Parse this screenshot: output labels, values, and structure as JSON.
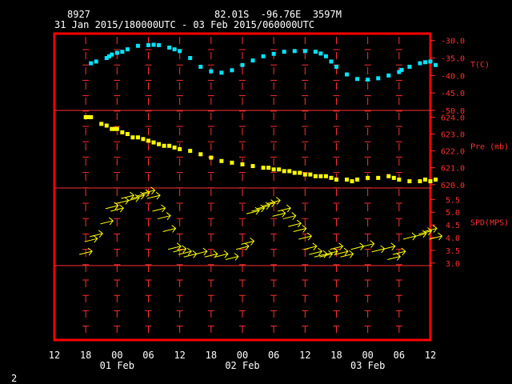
{
  "header": {
    "station": "8927",
    "location": "82.01S  -96.76E  3597M",
    "time_range": "31 Jan 2015/180000UTC - 03 Feb 2015/060000UTC"
  },
  "footer": {
    "page_number": "2"
  },
  "colors": {
    "background": "#000000",
    "frame": "#ff0000",
    "axis": "#ff3030",
    "temperature": "#00e5ff",
    "pressure": "#ffff00",
    "wind": "#ffff00",
    "text": "#ffffff"
  },
  "chart_data": [
    {
      "type": "scatter",
      "ylabel": "T(C)",
      "ylim": [
        -50,
        -28
      ],
      "yticks": [
        "-30.0",
        "-35.0",
        "-40.0",
        "-45.0",
        "-50.0"
      ],
      "x_hours": [
        19,
        20,
        22,
        22.5,
        23,
        24,
        25,
        26,
        28,
        30,
        31,
        32,
        34,
        35,
        36,
        38,
        40,
        42,
        44,
        46,
        48,
        50,
        52,
        54,
        56,
        58,
        60,
        62,
        63,
        64,
        65,
        66,
        68,
        70,
        72,
        74,
        76,
        78,
        78.5,
        80,
        82,
        83,
        84,
        85
      ],
      "values": [
        -36.5,
        -36,
        -35,
        -34.5,
        -34,
        -33.5,
        -33.2,
        -32.5,
        -31.5,
        -31.3,
        -31.2,
        -31.3,
        -32,
        -32.5,
        -33,
        -35,
        -37.5,
        -38.8,
        -39.2,
        -38.5,
        -37,
        -35.7,
        -34.5,
        -33.8,
        -33.2,
        -33,
        -33,
        -33.2,
        -33.7,
        -34.5,
        -36,
        -37.5,
        -39.7,
        -41,
        -41.2,
        -40.8,
        -40,
        -39,
        -38.4,
        -37.5,
        -36.5,
        -36.2,
        -36,
        -37
      ]
    },
    {
      "type": "scatter",
      "ylabel": "Pre (mb)",
      "ylim": [
        619.8,
        624.4
      ],
      "yticks": [
        "624.0",
        "623.0",
        "622.0",
        "621.0",
        "620.0"
      ],
      "x_hours": [
        18,
        18.5,
        19,
        21,
        22,
        23,
        23.5,
        24,
        25,
        26,
        27,
        28,
        29,
        30,
        31,
        32,
        33,
        34,
        35,
        36,
        38,
        40,
        42,
        44,
        46,
        48,
        50,
        52,
        53,
        54,
        55,
        56,
        57,
        58,
        59,
        60,
        61,
        62,
        63,
        64,
        65,
        66,
        68,
        69,
        70,
        72,
        74,
        76,
        77,
        78,
        80,
        82,
        83,
        84,
        85
      ],
      "values": [
        624,
        624,
        624,
        623.6,
        623.5,
        623.3,
        623.3,
        623.3,
        623.1,
        623,
        622.8,
        622.8,
        622.7,
        622.6,
        622.5,
        622.4,
        622.3,
        622.3,
        622.2,
        622.1,
        622,
        621.8,
        621.6,
        621.4,
        621.3,
        621.2,
        621.1,
        621,
        621,
        620.9,
        620.9,
        620.8,
        620.8,
        620.7,
        620.7,
        620.6,
        620.6,
        620.5,
        620.5,
        620.5,
        620.4,
        620.3,
        620.3,
        620.2,
        620.3,
        620.4,
        620.4,
        620.5,
        620.4,
        620.3,
        620.2,
        620.2,
        620.3,
        620.2,
        620.3
      ]
    },
    {
      "type": "scatter",
      "ylabel": "SPD(MPS)",
      "ylim": [
        2.9,
        5.95
      ],
      "yticks": [
        "5.5",
        "5.0",
        "4.5",
        "4.0",
        "3.5",
        "3.0"
      ],
      "x_hours": [
        18,
        19,
        20,
        22,
        23,
        24,
        25,
        26,
        27,
        28,
        29,
        30,
        31,
        32,
        33,
        34,
        35,
        36,
        37,
        38,
        40,
        42,
        44,
        46,
        48,
        49,
        50,
        51,
        52,
        53,
        54,
        55,
        56,
        57,
        58,
        59,
        60,
        61,
        62,
        63,
        64,
        65,
        66,
        67,
        68,
        70,
        72,
        74,
        76,
        77,
        78,
        80,
        82,
        83,
        84,
        85
      ],
      "values": [
        3.4,
        3.9,
        4.1,
        4.6,
        5.2,
        5.1,
        5.4,
        5.6,
        5.5,
        5.6,
        5.7,
        5.8,
        5.6,
        5.1,
        4.8,
        4.3,
        3.6,
        3.5,
        3.4,
        3.3,
        3.4,
        3.3,
        3.3,
        3.2,
        3.6,
        3.8,
        5.0,
        5.1,
        5.2,
        5.3,
        5.4,
        4.9,
        5.1,
        4.8,
        4.5,
        4.3,
        4.0,
        3.6,
        3.4,
        3.3,
        3.3,
        3.4,
        3.6,
        3.4,
        3.3,
        3.6,
        3.7,
        3.5,
        3.6,
        3.2,
        3.4,
        4.0,
        4.1,
        4.2,
        4.3,
        4.0
      ]
    }
  ],
  "x_axis": {
    "hour_labels": [
      "12",
      "18",
      "00",
      "06",
      "12",
      "18",
      "00",
      "06",
      "12",
      "18",
      "00",
      "06",
      "12"
    ],
    "day_labels": [
      "01 Feb",
      "02 Feb",
      "03 Feb"
    ]
  }
}
